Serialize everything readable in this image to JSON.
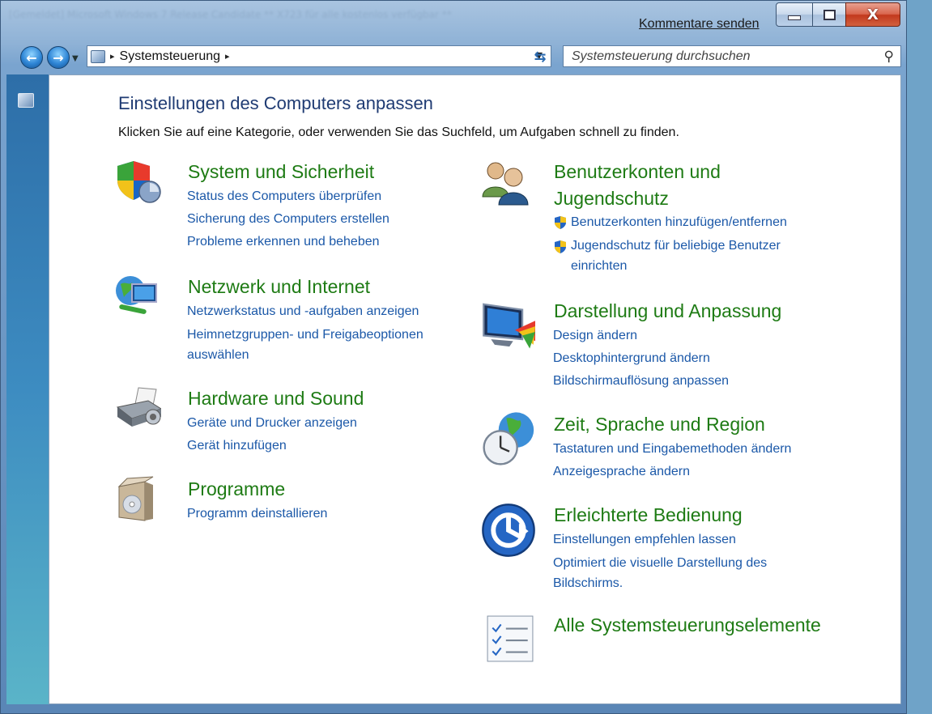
{
  "window": {
    "title_blurred": "[Gemeldet] Microsoft Windows 7 Release Candidate ** X723 für alle kostenlos verfügbar **",
    "feedback_link": "Kommentare senden",
    "close_glyph": "X"
  },
  "navigation": {
    "address_root_sep": "▸",
    "address_path": "Systemsteuerung",
    "address_sep": "▸",
    "search_placeholder": "Systemsteuerung durchsuchen"
  },
  "page": {
    "title": "Einstellungen des Computers anpassen",
    "subtitle": "Klicken Sie auf eine Kategorie, oder verwenden Sie das Suchfeld, um Aufgaben schnell zu finden."
  },
  "categories": {
    "system": {
      "title": "System und Sicherheit",
      "links": [
        "Status des Computers überprüfen",
        "Sicherung des Computers erstellen",
        "Probleme erkennen und beheben"
      ]
    },
    "network": {
      "title": "Netzwerk und Internet",
      "links": [
        "Netzwerkstatus und -aufgaben anzeigen",
        "Heimnetzgruppen- und Freigabeoptionen auswählen"
      ]
    },
    "hardware": {
      "title": "Hardware und Sound",
      "links": [
        "Geräte und Drucker anzeigen",
        "Gerät hinzufügen"
      ]
    },
    "programs": {
      "title": "Programme",
      "links": [
        "Programm deinstallieren"
      ]
    },
    "users": {
      "title_line1": "Benutzerkonten und",
      "title_line2": "Jugendschutz",
      "links": [
        "Benutzerkonten hinzufügen/entfernen",
        "Jugendschutz für beliebige Benutzer einrichten"
      ]
    },
    "appearance": {
      "title": "Darstellung und Anpassung",
      "links": [
        "Design ändern",
        "Desktophintergrund ändern",
        "Bildschirmauflösung anpassen"
      ]
    },
    "clock": {
      "title": "Zeit, Sprache und Region",
      "links": [
        "Tastaturen und Eingabemethoden ändern",
        "Anzeigesprache ändern"
      ]
    },
    "ease": {
      "title": "Erleichterte Bedienung",
      "links": [
        "Einstellungen empfehlen lassen",
        "Optimiert die visuelle Darstellung des Bildschirms."
      ]
    },
    "all": {
      "title": "Alle Systemsteuerungselemente"
    }
  }
}
